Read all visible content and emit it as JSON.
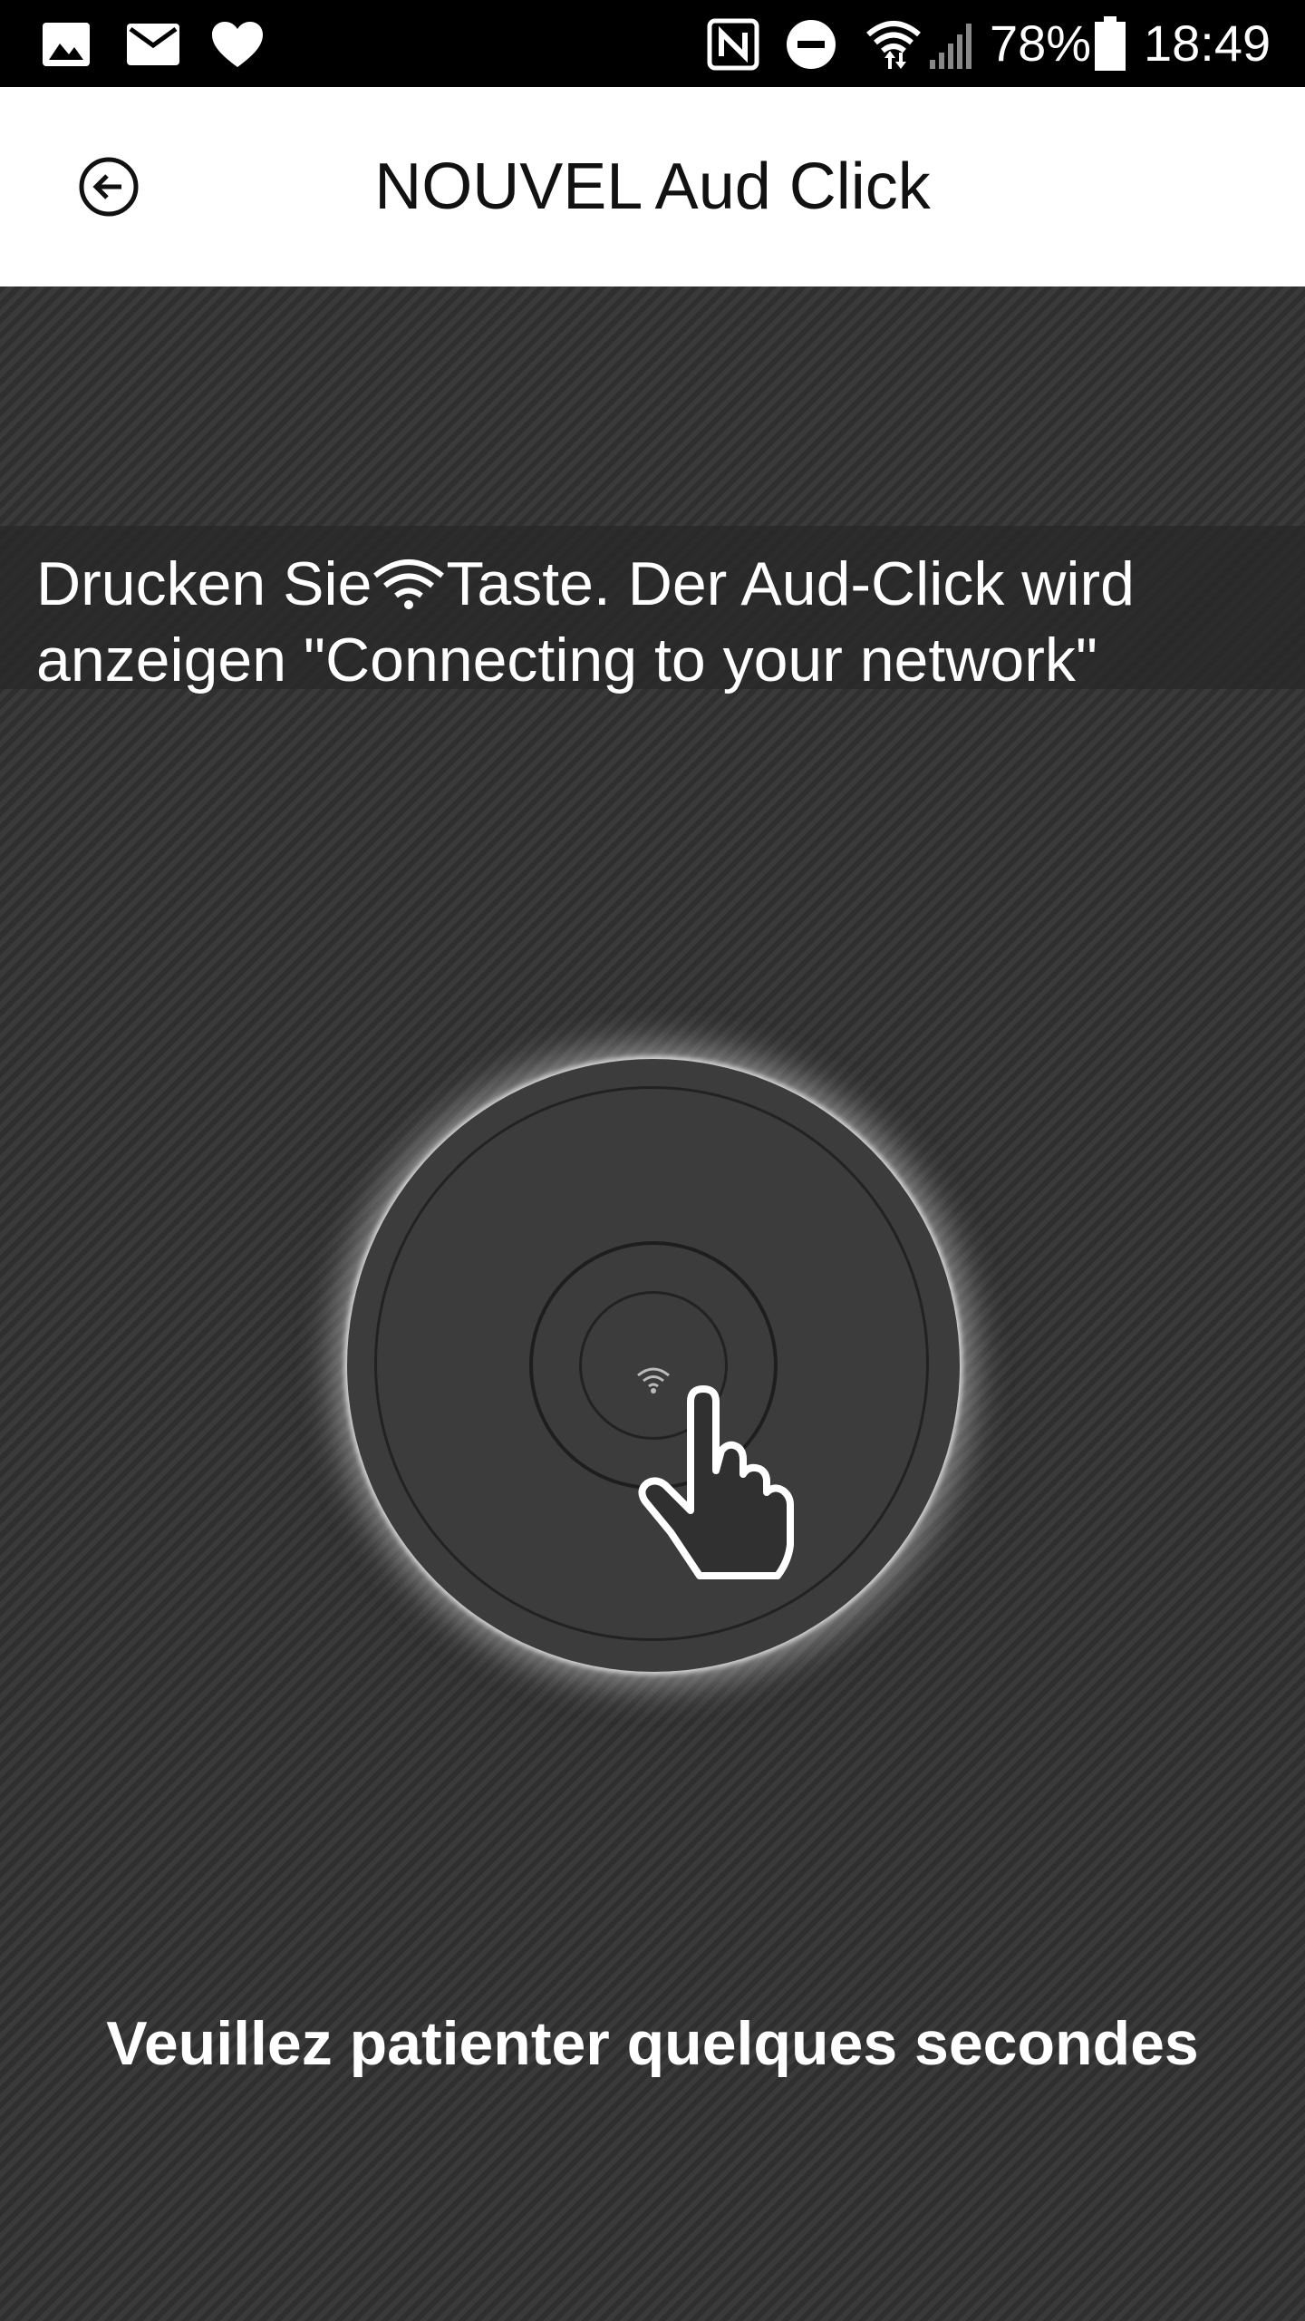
{
  "status_bar": {
    "battery_percent": "78%",
    "time": "18:49",
    "icons": [
      "gallery-icon",
      "mail-icon",
      "heart-icon",
      "nfc-icon",
      "do-not-disturb-icon",
      "wifi-icon",
      "signal-icon",
      "battery-icon"
    ]
  },
  "app_bar": {
    "title": "NOUVEL Aud Click",
    "back_icon": "back-arrow-icon"
  },
  "instruction": {
    "before_icon": "Drucken Sie",
    "icon": "wifi-icon",
    "after_icon": "Taste. Der Aud-Click wird anzeigen \"Connecting to your network\""
  },
  "device": {
    "icon": "wifi-icon",
    "pointer": "hand-pointer-icon"
  },
  "footer": {
    "wait_text": "Veuillez patienter quelques secondes"
  },
  "colors": {
    "status_bar_bg": "#000000",
    "app_bar_bg": "#ffffff",
    "content_bg": "#323232",
    "text_on_dark": "#ffffff"
  }
}
